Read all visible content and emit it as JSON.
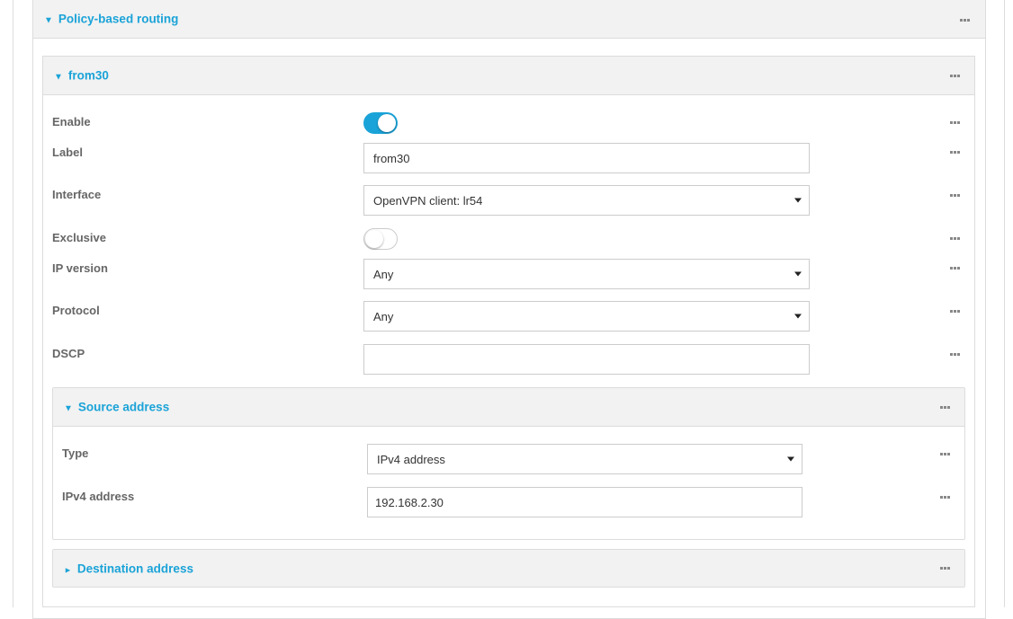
{
  "policy_section": {
    "title": "Policy-based routing"
  },
  "route": {
    "title": "from30",
    "fields": {
      "enable": {
        "label": "Enable",
        "value": true
      },
      "label": {
        "label": "Label",
        "value": "from30"
      },
      "interface": {
        "label": "Interface",
        "value": "OpenVPN client: lr54"
      },
      "exclusive": {
        "label": "Exclusive",
        "value": false
      },
      "ip_version": {
        "label": "IP version",
        "value": "Any"
      },
      "protocol": {
        "label": "Protocol",
        "value": "Any"
      },
      "dscp": {
        "label": "DSCP",
        "value": ""
      }
    },
    "source": {
      "title": "Source address",
      "type": {
        "label": "Type",
        "value": "IPv4 address"
      },
      "ipv4": {
        "label": "IPv4 address",
        "value": "192.168.2.30"
      }
    },
    "destination": {
      "title": "Destination address"
    }
  },
  "colors": {
    "accent": "#1aa3d8",
    "header_bg": "#f2f2f2",
    "border": "#dcdcdc"
  },
  "icons": {
    "expanded": "caret-down-icon",
    "collapsed": "caret-right-icon",
    "menu": "more-icon"
  }
}
